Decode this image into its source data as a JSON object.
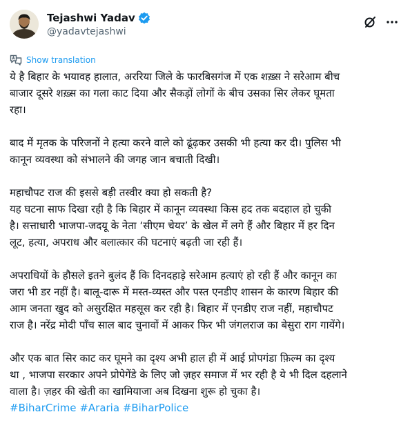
{
  "author": {
    "display_name": "Tejashwi Yadav",
    "handle": "@yadavtejashwi"
  },
  "show_translation": "Show translation",
  "icons": {
    "verified": "verified-badge-icon",
    "grok": "grok-icon",
    "more": "more-options-icon",
    "translate": "translate-icon"
  },
  "colors": {
    "link": "#1d9bf0",
    "text": "#0f1419",
    "secondary": "#536471"
  },
  "paragraphs": [
    [
      "ये है बिहार के भयावह हालात, अररिया जिले के फारबिसगंज में एक शख़्स ने सरेआम बीच",
      "बाजार दूसरे शख़्स का गला काट दिया और सैकड़ों लोगों के बीच उसका सिर लेकर घूमता",
      "रहा।"
    ],
    [
      "बाद में मृतक के परिजनों ने हत्या करने वाले को ढूंढ़कर उसकी  भी हत्या कर दी। पुलिस भी",
      "कानून व्यवस्था को संभालने की जगह जान बचाती दिखी।"
    ],
    [
      "महाचौपट राज की इससे बड़ी तस्वीर क्या हो सकती है?",
      "यह घटना साफ दिखा रही है कि बिहार में कानून व्यवस्था किस हद तक बदहाल हो चुकी",
      "है। सत्ताधारी भाजपा-जदयू के नेता ‘सीएम चेयर’ के खेल में लगे हैं और बिहार में हर दिन",
      "लूट, हत्या, अपराध और बलात्कार की घटनाएं बढ़ती जा रही हैं।"
    ],
    [
      "अपराधियों के हौसले इतने बुलंद हैं कि दिनदहाड़े सरेआम हत्याएं हो रही हैं और कानून का",
      "जरा भी डर नहीं है। बालू-दारू में मस्त-व्यस्त और पस्त एनडीए शासन के कारण बिहार की",
      "आम जनता खुद को असुरक्षित महसूस कर रही है। बिहार में एनडीए राज नहीं, महाचौपट",
      "राज है। नरेंद्र मोदी पाँच साल बाद चुनावों में आकर फिर भी जंगलराज का बेसुरा राग गायेंगे।"
    ],
    [
      "और एक बात सिर काट कर घूमने का दृश्य अभी हाल ही में आई प्रोपगंडा फ़िल्म का दृश्य",
      "था , भाजपा सरकार अपने प्रोपेगेंडे के लिए जो ज़हर समाज में भर रही है ये भी दिल दहलाने",
      "वाला है। ज़हर की खेती का खामियाजा अब दिखना शुरू हो चुका है।"
    ]
  ],
  "hashtags": [
    "#BiharCrime",
    "#Araria",
    "#BiharPolice"
  ]
}
